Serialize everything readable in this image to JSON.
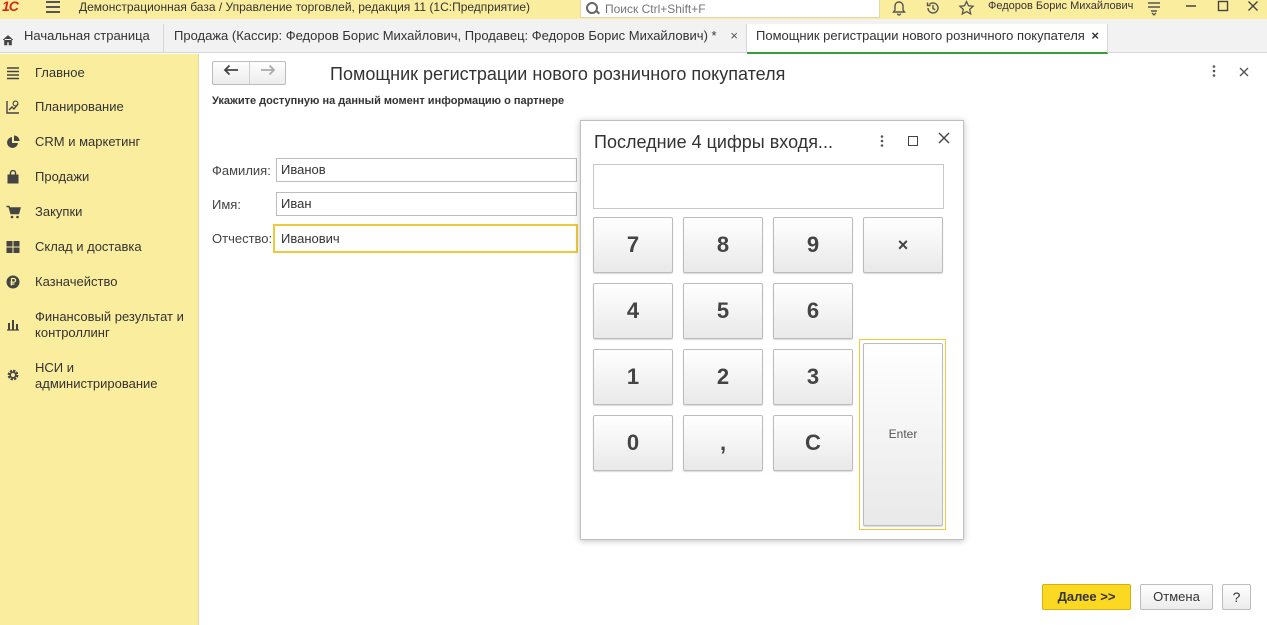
{
  "titlebar": {
    "logo_text": "1С",
    "app_title": "Демонстрационная база / Управление торговлей, редакция 11  (1С:Предприятие)",
    "search_placeholder": "Поиск Ctrl+Shift+F",
    "user": "Федоров Борис Михайлович",
    "icons": [
      "bell-icon",
      "history-icon",
      "star-icon",
      "settings-menu-icon",
      "minimize-icon",
      "maximize-icon",
      "close-icon"
    ]
  },
  "tabs": [
    {
      "label": "Начальная страница",
      "icon": "home-icon"
    },
    {
      "label": "Продажа (Кассир: Федоров Борис Михайлович, Продавец: Федоров Борис Михайлович) *",
      "close": "×"
    },
    {
      "label": "Помощник регистрации нового розничного покупателя",
      "close": "×",
      "active": true
    }
  ],
  "sidebar": {
    "items": [
      {
        "label": "Главное",
        "icon": "menu-icon"
      },
      {
        "label": "Планирование",
        "icon": "planning-icon"
      },
      {
        "label": "CRM и маркетинг",
        "icon": "pie-chart-icon"
      },
      {
        "label": "Продажи",
        "icon": "bag-icon"
      },
      {
        "label": "Закупки",
        "icon": "cart-icon"
      },
      {
        "label": "Склад и доставка",
        "icon": "warehouse-icon"
      },
      {
        "label": "Казначейство",
        "icon": "treasury-icon"
      },
      {
        "label": "Финансовый результат и контроллинг",
        "icon": "bar-chart-icon"
      },
      {
        "label": "НСИ и администрирование",
        "icon": "gear-icon"
      }
    ]
  },
  "form": {
    "title": "Помощник регистрации нового розничного покупателя",
    "hint": "Укажите доступную на данный момент информацию о партнере",
    "fields": [
      {
        "label": "Фамилия:",
        "value": "Иванов"
      },
      {
        "label": "Имя:",
        "value": "Иван"
      },
      {
        "label": "Отчество:",
        "value": "Иванович"
      }
    ],
    "buttons": {
      "next": "Далее >>",
      "cancel": "Отмена",
      "help": "?"
    }
  },
  "dialog": {
    "title": "Последние 4 цифры входя...",
    "display_value": "",
    "keys": [
      "7",
      "8",
      "9",
      "×",
      "4",
      "5",
      "6",
      "1",
      "2",
      "3",
      "0",
      ",",
      "C",
      "Enter"
    ]
  }
}
